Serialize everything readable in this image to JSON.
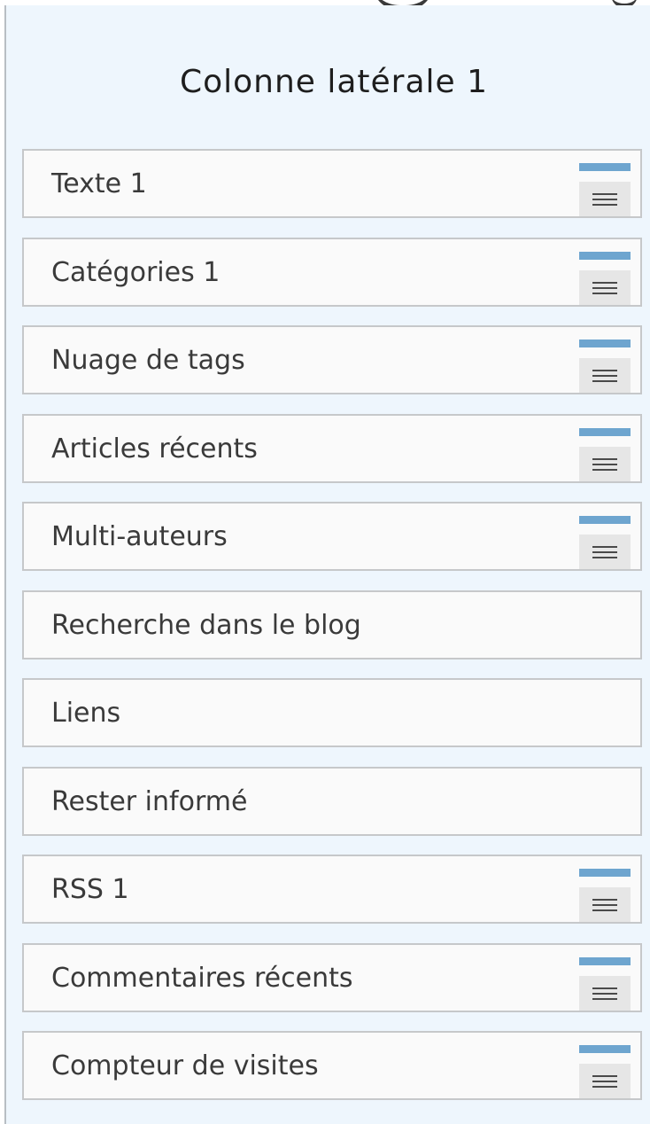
{
  "sidebar": {
    "title": "Colonne latérale 1",
    "widgets": [
      {
        "label": "Texte 1",
        "has_menu": true
      },
      {
        "label": "Catégories 1",
        "has_menu": true
      },
      {
        "label": "Nuage de tags",
        "has_menu": true
      },
      {
        "label": "Articles récents",
        "has_menu": true
      },
      {
        "label": "Multi-auteurs",
        "has_menu": true
      },
      {
        "label": "Recherche dans le blog",
        "has_menu": false
      },
      {
        "label": "Liens",
        "has_menu": false
      },
      {
        "label": "Rester informé",
        "has_menu": false
      },
      {
        "label": "RSS 1",
        "has_menu": true
      },
      {
        "label": "Commentaires récents",
        "has_menu": true
      },
      {
        "label": "Compteur de visites",
        "has_menu": true
      }
    ]
  },
  "icons": {
    "menu": "hamburger-menu-icon"
  },
  "colors": {
    "column_background": "#eef6fd",
    "widget_background": "#fafafa",
    "widget_border": "#c6c8ca",
    "accent": "#6ea5cf",
    "menu_button": "#e6e6e6"
  }
}
